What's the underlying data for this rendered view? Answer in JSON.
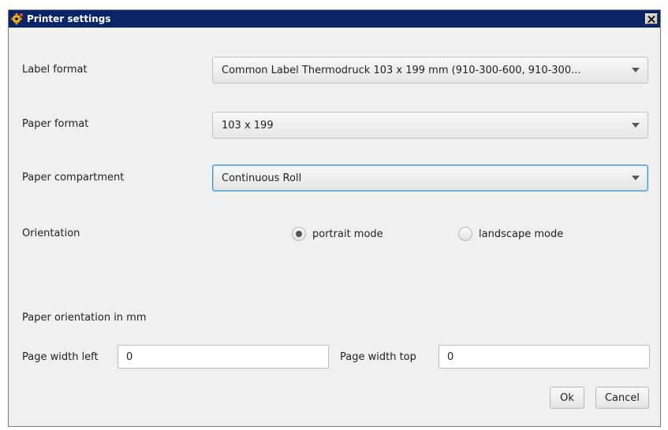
{
  "window": {
    "title": "Printer settings"
  },
  "form": {
    "label_format": {
      "label": "Label format",
      "value": "Common Label Thermodruck 103 x 199 mm (910-300-600, 910-300..."
    },
    "paper_format": {
      "label": "Paper format",
      "value": "103 x 199"
    },
    "paper_compartment": {
      "label": "Paper compartment",
      "value": "Continuous Roll"
    },
    "orientation": {
      "label": "Orientation",
      "options": [
        {
          "label": "portrait mode",
          "selected": true
        },
        {
          "label": "landscape mode",
          "selected": false
        }
      ]
    },
    "paper_orientation_heading": "Paper orientation in mm",
    "page_width_left": {
      "label": "Page width left",
      "value": "0"
    },
    "page_width_top": {
      "label": "Page width  top",
      "value": "0"
    }
  },
  "buttons": {
    "ok": "Ok",
    "cancel": "Cancel"
  },
  "icons": {
    "app": "gear-icon",
    "close": "close-icon",
    "dropdown": "chevron-down-icon"
  },
  "colors": {
    "titlebar": "#0a246a",
    "focus_border": "#3a93e0"
  }
}
